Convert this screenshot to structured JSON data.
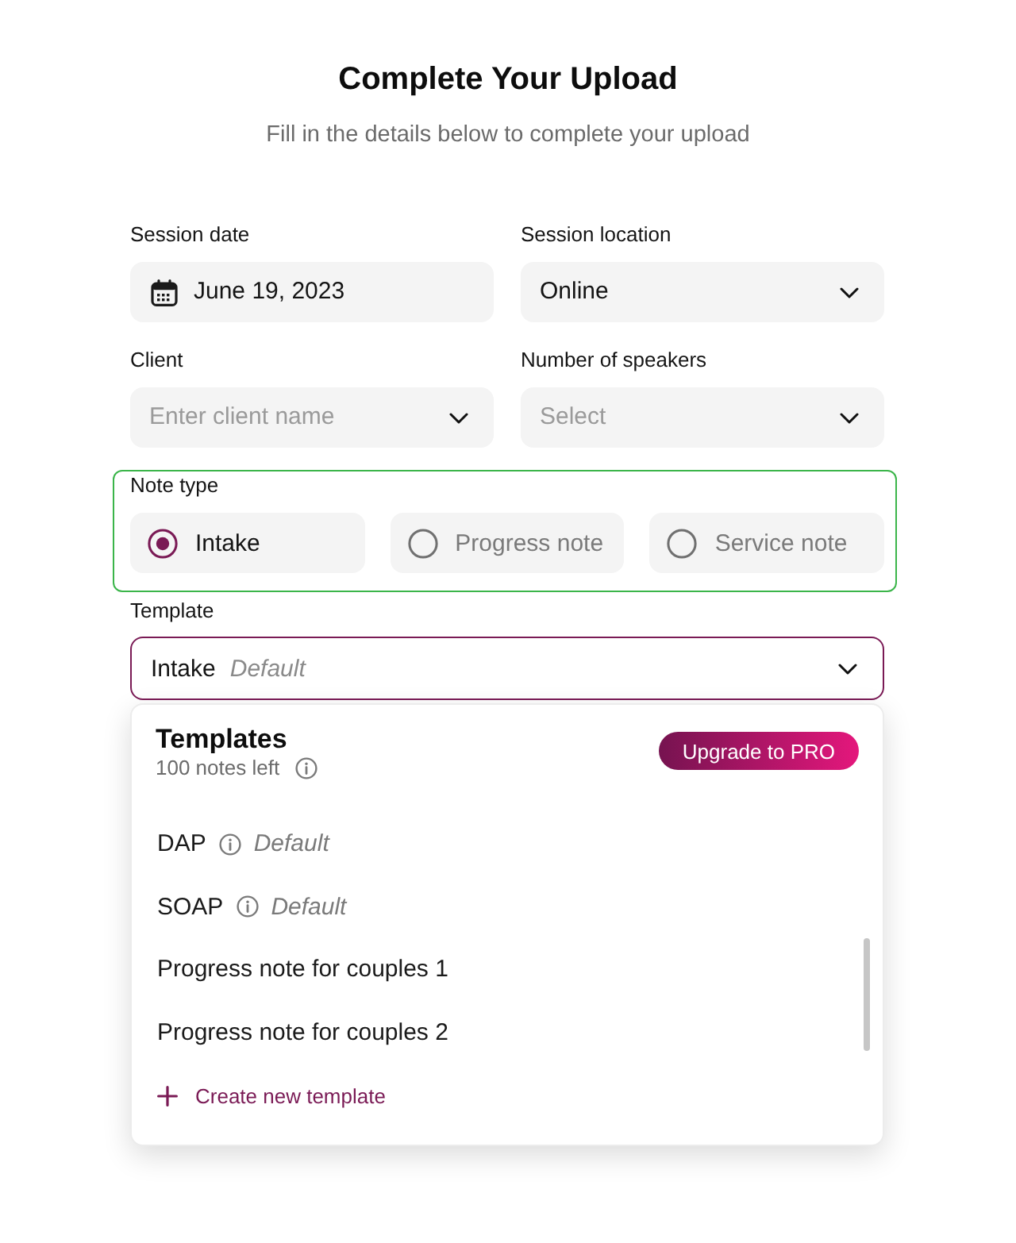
{
  "header": {
    "title": "Complete Your Upload",
    "subtitle": "Fill in the details below to complete your upload"
  },
  "fields": [
    {
      "kind": "date",
      "label": "Session date",
      "value": "June 19, 2023"
    },
    {
      "kind": "select",
      "label": "Session location",
      "value": "Online"
    },
    {
      "kind": "select",
      "label": "Client",
      "placeholder": "Enter client name"
    },
    {
      "kind": "select",
      "label": "Number of speakers",
      "placeholder": "Select"
    }
  ],
  "note_type": {
    "label": "Note type",
    "focused": true,
    "options": [
      {
        "label": "Intake",
        "selected": true
      },
      {
        "label": "Progress note",
        "selected": false
      },
      {
        "label": "Service note",
        "selected": false
      }
    ]
  },
  "template": {
    "label": "Template",
    "value": "Intake",
    "tag": "Default",
    "expanded": true
  },
  "template_menu": {
    "title": "Templates",
    "subtitle": "100 notes left",
    "button": "Upgrade to PRO",
    "items": [
      {
        "name": "DAP",
        "tag": "Default",
        "selected": false
      },
      {
        "name": "SOAP",
        "tag": "Default",
        "selected": false
      },
      {
        "name": "Progress note for couples 1",
        "selected": false
      },
      {
        "name": "Progress note for couples 2",
        "selected": false
      }
    ],
    "create": "Create new template"
  }
}
